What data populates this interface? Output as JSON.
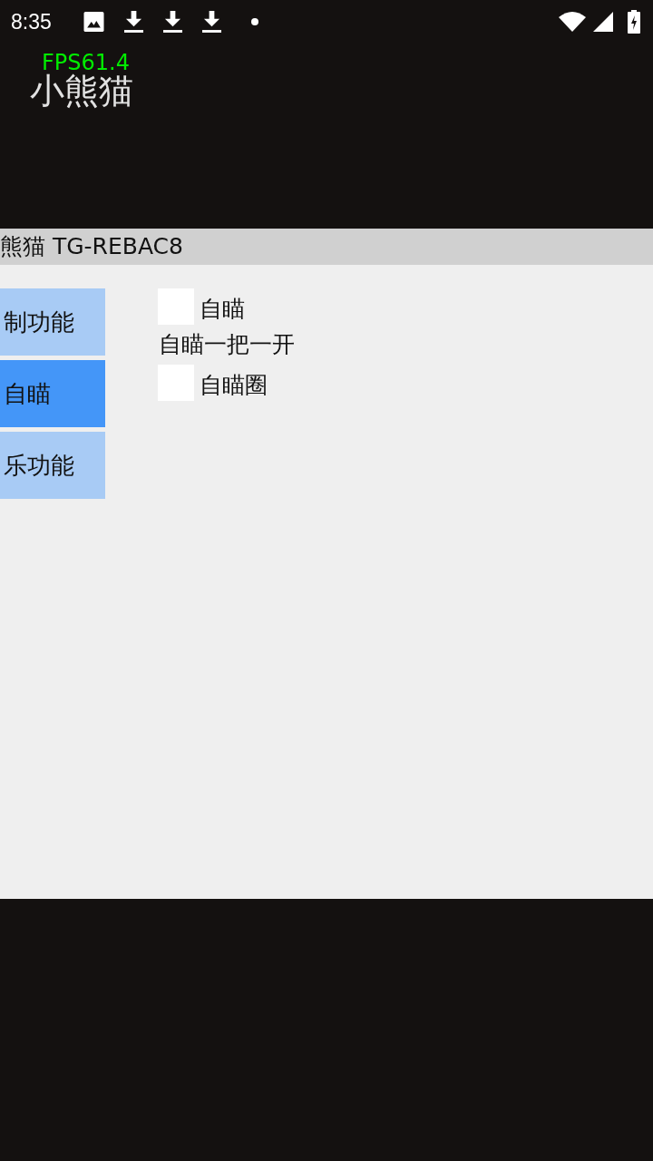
{
  "status_bar": {
    "time": "8:35"
  },
  "overlay": {
    "fps": "FPS61.4",
    "title": "小熊猫"
  },
  "menu": {
    "title": "熊猫 TG-REBAC8",
    "tabs": [
      {
        "label": "制功能",
        "selected": false
      },
      {
        "label": "自瞄",
        "selected": true
      },
      {
        "label": "乐功能",
        "selected": false
      }
    ],
    "options": [
      {
        "kind": "checkbox",
        "label": "自瞄",
        "checked": false
      },
      {
        "kind": "heading",
        "label": "自瞄一把一开"
      },
      {
        "kind": "checkbox",
        "label": "自瞄圈",
        "checked": false
      }
    ]
  }
}
